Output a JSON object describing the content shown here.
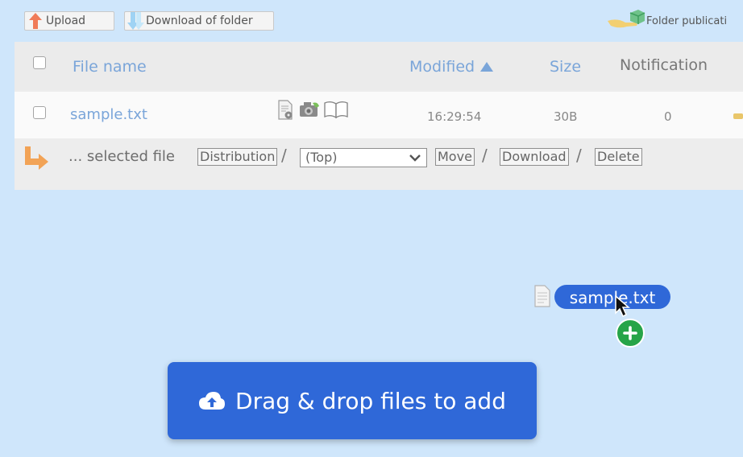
{
  "toolbar": {
    "upload_label": "Upload",
    "download_folder_label": "Download of folder",
    "folder_publication_label": "Folder publicati"
  },
  "table": {
    "headers": {
      "file_name": "File name",
      "modified": "Modified",
      "size": "Size",
      "notification": "Notification"
    },
    "rows": [
      {
        "name": "sample.txt",
        "modified": "16:29:54",
        "size": "30B",
        "notification": "0"
      }
    ]
  },
  "actions": {
    "selected_label": "... selected file",
    "distribution_label": "Distribution",
    "separator": "/",
    "destination_value": "(Top)",
    "move_label": "Move",
    "download_label": "Download",
    "delete_label": "Delete"
  },
  "drag": {
    "file_label": "sample.txt"
  },
  "drop_banner": {
    "label": "Drag & drop files to add"
  },
  "colors": {
    "background": "#cfe6fb",
    "accent_blue": "#2f68d8",
    "link_blue": "#7aa5d9",
    "upload_arrow": "#f07b58",
    "action_arrow": "#f2a356",
    "plus_green": "#26a448"
  },
  "icons": {
    "upload": "up-arrow-icon",
    "download_folder": "down-arrow-icon",
    "folder_publication": "hand-cube-icon",
    "sort": "triangle-up-icon",
    "row_actions": [
      "file-info-icon",
      "camera-icon",
      "book-icon"
    ],
    "selected_action": "corner-arrow-icon",
    "dropdown": "chevron-down-icon",
    "drag_file": "file-icon",
    "cursor": "cursor-arrow-icon",
    "add": "plus-icon",
    "banner": "cloud-upload-icon"
  }
}
